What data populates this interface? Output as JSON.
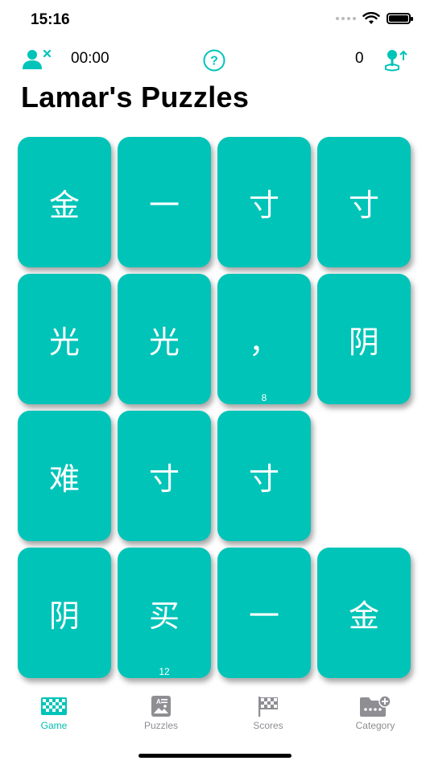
{
  "status_bar": {
    "time": "15:16"
  },
  "header": {
    "timer": "00:00",
    "score": "0",
    "title": "Lamar's Puzzles",
    "help_label": "?"
  },
  "tiles": [
    {
      "char": "金",
      "badge": ""
    },
    {
      "char": "一",
      "badge": ""
    },
    {
      "char": "寸",
      "badge": ""
    },
    {
      "char": "寸",
      "badge": ""
    },
    {
      "char": "光",
      "badge": ""
    },
    {
      "char": "光",
      "badge": ""
    },
    {
      "char": "，",
      "badge": "8"
    },
    {
      "char": "阴",
      "badge": ""
    },
    {
      "char": "难",
      "badge": ""
    },
    {
      "char": "寸",
      "badge": ""
    },
    {
      "char": "寸",
      "badge": ""
    },
    {
      "char": "阴",
      "badge": ""
    },
    {
      "char": "买",
      "badge": "12"
    },
    {
      "char": "一",
      "badge": ""
    },
    {
      "char": "金",
      "badge": ""
    }
  ],
  "tabs": [
    {
      "label": "Game",
      "icon": "checkerboard-icon",
      "active": true
    },
    {
      "label": "Puzzles",
      "icon": "puzzle-card-icon",
      "active": false
    },
    {
      "label": "Scores",
      "icon": "checkered-flag-icon",
      "active": false
    },
    {
      "label": "Category",
      "icon": "folder-add-icon",
      "active": false
    }
  ],
  "colors": {
    "accent": "#00c4b8",
    "tab_active": "#00bdb0",
    "tab_inactive": "#8e8e93"
  }
}
